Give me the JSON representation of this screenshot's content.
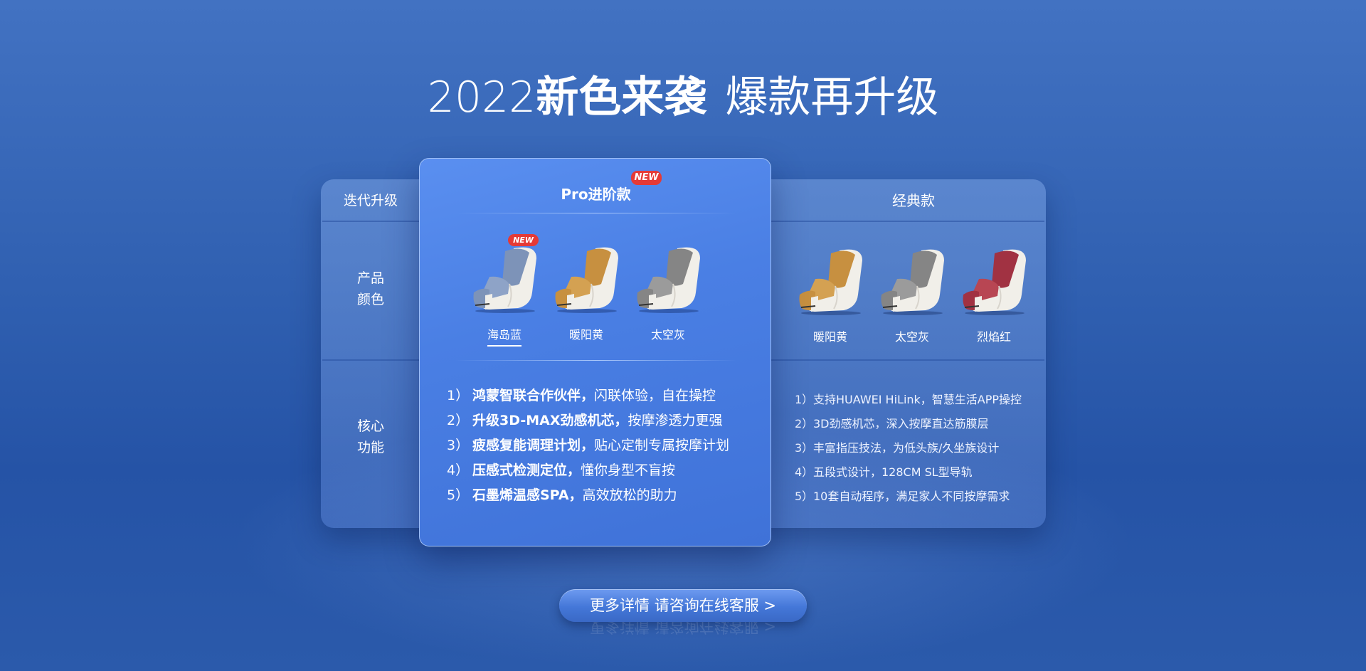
{
  "headline": {
    "year": "2022",
    "part1": "新色来袭",
    "part2": "爆款再升级"
  },
  "left_column": {
    "header": "迭代升级",
    "row1": [
      "产品",
      "颜色"
    ],
    "row2": [
      "核心",
      "功能"
    ]
  },
  "pro": {
    "title": "Pro进阶款",
    "badge": "NEW",
    "colors": [
      {
        "label": "海岛蓝",
        "badge": "NEW",
        "selected": true,
        "seat": "#8ea3c7",
        "back": "#7d93b8"
      },
      {
        "label": "暖阳黄",
        "seat": "#d4a152",
        "back": "#c79040"
      },
      {
        "label": "太空灰",
        "seat": "#9b9b9b",
        "back": "#858585"
      }
    ],
    "features": [
      {
        "num": "1）",
        "strong": "鸿蒙智联合作伙伴，",
        "rest": "闪联体验，自在操控"
      },
      {
        "num": "2）",
        "strong": "升级3D-MAX劲感机芯，",
        "rest": "按摩渗透力更强"
      },
      {
        "num": "3）",
        "strong": "疲感复能调理计划，",
        "rest": "贴心定制专属按摩计划"
      },
      {
        "num": "4）",
        "strong": "压感式检测定位，",
        "rest": "懂你身型不盲按"
      },
      {
        "num": "5）",
        "strong": "石墨烯温感SPA，",
        "rest": " 高效放松的助力"
      }
    ]
  },
  "classic": {
    "title": "经典款",
    "colors": [
      {
        "label": "暖阳黄",
        "seat": "#d4a152",
        "back": "#c79040"
      },
      {
        "label": "太空灰",
        "seat": "#9b9b9b",
        "back": "#858585"
      },
      {
        "label": "烈焰红",
        "seat": "#b84653",
        "back": "#a13242"
      }
    ],
    "features": [
      {
        "num": "1）",
        "text": "支持HUAWEI HiLink，智慧生活APP操控"
      },
      {
        "num": "2）",
        "text": "3D劲感机芯，深入按摩直达筋膜层"
      },
      {
        "num": "3）",
        "text": "丰富指压技法，为低头族/久坐族设计"
      },
      {
        "num": "4）",
        "text": "五段式设计，128CM SL型导轨"
      },
      {
        "num": "5）",
        "text": "10套自动程序，满足家人不同按摩需求"
      }
    ]
  },
  "cta": {
    "label": "更多详情  请咨询在线客服 >"
  }
}
